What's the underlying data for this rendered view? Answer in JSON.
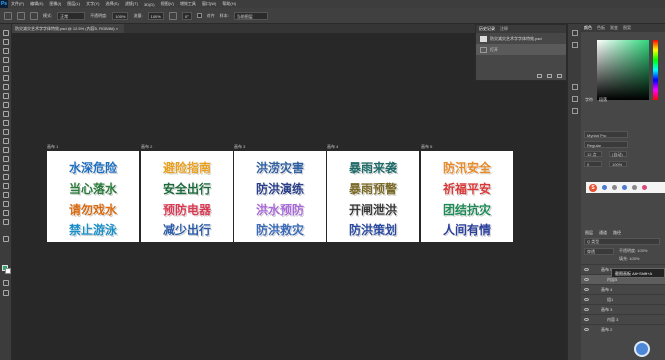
{
  "app": {
    "logo": "Ps"
  },
  "menubar": [
    "文件(F)",
    "编辑(E)",
    "图像(I)",
    "图层(L)",
    "文字(Y)",
    "选择(S)",
    "滤镜(T)",
    "3D(D)",
    "视图(V)",
    "增效工具",
    "窗口(W)",
    "帮助(H)"
  ],
  "options": {
    "mode_label": "模式:",
    "mode_value": "正常",
    "opacity_label": "不透明度:",
    "opacity_value": "100%",
    "flow_label": "流量:",
    "flow_value": "100%",
    "angle_value": "0°",
    "align_label": "对齐",
    "sample_label": "样本:",
    "sample_value": "当前图层"
  },
  "document_tab": "防灾减灾艺术字字体特效.psd @ 12.5% (内容5, RGB/8#) ×",
  "artboards": [
    {
      "label": "画布 1",
      "lines": [
        "水深危险",
        "当心落水",
        "请勿戏水",
        "禁止游泳"
      ],
      "colors": [
        "#1f6fc0",
        "#2a7a3a",
        "#d86a10",
        "#1b8fc8"
      ]
    },
    {
      "label": "画布 2",
      "lines": [
        "避险指南",
        "安全出行",
        "预防电器",
        "减少出行"
      ],
      "colors": [
        "#e8a020",
        "#1a6a3a",
        "#d83a52",
        "#2a5aa8"
      ]
    },
    {
      "label": "画布 3",
      "lines": [
        "洪涝灾害",
        "防洪演练",
        "洪水预防",
        "防洪救灾"
      ],
      "colors": [
        "#2f5fa0",
        "#2a3f8a",
        "#a86ad8",
        "#3a6ab8"
      ]
    },
    {
      "label": "画布 4",
      "lines": [
        "暴雨来袭",
        "暴雨预警",
        "开闸泄洪",
        "防洪策划"
      ],
      "colors": [
        "#1f6a68",
        "#7a6a28",
        "#3a3a3a",
        "#2a4aa0"
      ]
    },
    {
      "label": "画布 5",
      "lines": [
        "防汛安全",
        "祈福平安",
        "团结抗灾",
        "人间有情"
      ],
      "colors": [
        "#e88a28",
        "#d83838",
        "#1f8a58",
        "#2a3f9a"
      ]
    }
  ],
  "history_panel": {
    "tabs": [
      "历史记录",
      "注释"
    ],
    "rows": [
      "防灾减灾艺术字字体特效.psd",
      "打开"
    ]
  },
  "color_panel": {
    "tabs": [
      "颜色",
      "色板",
      "渐变",
      "图案"
    ]
  },
  "character_panel": {
    "tabs": [
      "字符",
      "段落"
    ],
    "font": "Myriad Pro",
    "style": "Regular",
    "size": "12 点",
    "leading": "(自动)",
    "tracking": "0",
    "scale": "100%"
  },
  "input_method": {
    "logo": "S"
  },
  "layers_panel": {
    "tabs": [
      "图层",
      "通道",
      "路径"
    ],
    "filter": "Q 类型",
    "blend_mode": "穿透",
    "opacity_label": "不透明度:",
    "opacity_value": "100%",
    "fill_label": "填充:",
    "fill_value": "100%",
    "rows": [
      "画布 5",
      "内容5",
      "画布 4",
      "组1",
      "画布 3",
      "内容 3",
      "画布 2"
    ],
    "tooltip": "截图画板 Alt+Shift+A"
  }
}
